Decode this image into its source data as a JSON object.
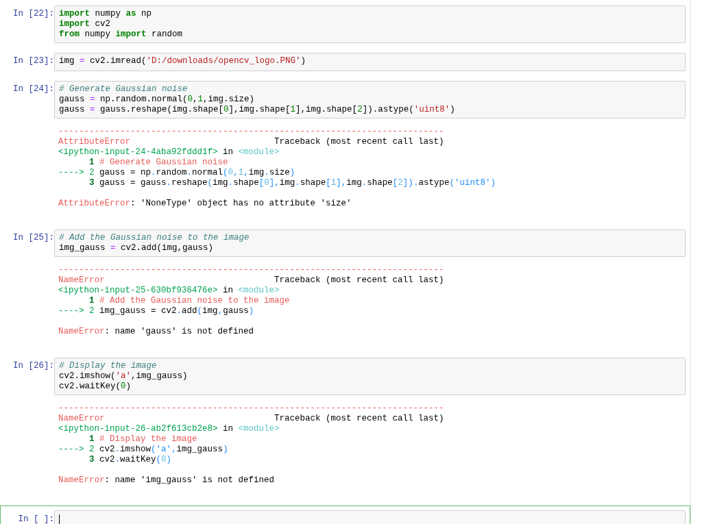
{
  "cells": [
    {
      "prompt": "In [22]:",
      "selected": false,
      "input": [
        [
          {
            "kind": "kw",
            "text": "import"
          },
          {
            "kind": "plain",
            "text": " numpy "
          },
          {
            "kind": "kw",
            "text": "as"
          },
          {
            "kind": "plain",
            "text": " np"
          }
        ],
        [
          {
            "kind": "kw",
            "text": "import"
          },
          {
            "kind": "plain",
            "text": " cv2"
          }
        ],
        [
          {
            "kind": "kw",
            "text": "from"
          },
          {
            "kind": "plain",
            "text": " numpy "
          },
          {
            "kind": "kw",
            "text": "import"
          },
          {
            "kind": "plain",
            "text": " random"
          }
        ]
      ]
    },
    {
      "prompt": "In [23]:",
      "selected": false,
      "input": [
        [
          {
            "kind": "plain",
            "text": "img "
          },
          {
            "kind": "op",
            "text": "="
          },
          {
            "kind": "plain",
            "text": " cv2.imread("
          },
          {
            "kind": "str",
            "text": "'D:/downloads/opencv_logo.PNG'"
          },
          {
            "kind": "plain",
            "text": ")"
          }
        ]
      ]
    },
    {
      "prompt": "In [24]:",
      "selected": false,
      "input": [
        [
          {
            "kind": "comment",
            "text": "# Generate Gaussian noise"
          }
        ],
        [
          {
            "kind": "plain",
            "text": "gauss "
          },
          {
            "kind": "op",
            "text": "="
          },
          {
            "kind": "plain",
            "text": " np.random.normal("
          },
          {
            "kind": "num",
            "text": "0"
          },
          {
            "kind": "plain",
            "text": ","
          },
          {
            "kind": "num",
            "text": "1"
          },
          {
            "kind": "plain",
            "text": ",img.size)"
          }
        ],
        [
          {
            "kind": "plain",
            "text": "gauss "
          },
          {
            "kind": "op",
            "text": "="
          },
          {
            "kind": "plain",
            "text": " gauss.reshape(img.shape["
          },
          {
            "kind": "num",
            "text": "0"
          },
          {
            "kind": "plain",
            "text": "],img.shape["
          },
          {
            "kind": "num",
            "text": "1"
          },
          {
            "kind": "plain",
            "text": "],img.shape["
          },
          {
            "kind": "num",
            "text": "2"
          },
          {
            "kind": "plain",
            "text": "]).astype("
          },
          {
            "kind": "str",
            "text": "'uint8'"
          },
          {
            "kind": "plain",
            "text": ")"
          }
        ]
      ],
      "output": {
        "traceback": [
          [
            {
              "kind": "ered",
              "text": "---------------------------------------------------------------------------"
            }
          ],
          [
            {
              "kind": "ered",
              "text": "AttributeError"
            },
            {
              "kind": "plain",
              "text": "                            Traceback (most recent call last)"
            }
          ],
          [
            {
              "kind": "egreen",
              "text": "<ipython-input-24-4aba92fddd1f>"
            },
            {
              "kind": "plain",
              "text": " in "
            },
            {
              "kind": "ecyan",
              "text": "<module>"
            }
          ],
          [
            {
              "kind": "lineno",
              "text": "1"
            },
            {
              "kind": "ered",
              "text": " # Generate Gaussian noise"
            }
          ],
          [
            {
              "kind": "egreen",
              "text": "----> 2"
            },
            {
              "kind": "plain",
              "text": " gauss = np"
            },
            {
              "kind": "punct",
              "text": "."
            },
            {
              "kind": "plain",
              "text": "random"
            },
            {
              "kind": "punct",
              "text": "."
            },
            {
              "kind": "plain",
              "text": "normal"
            },
            {
              "kind": "punct",
              "text": "("
            },
            {
              "kind": "tnum",
              "text": "0"
            },
            {
              "kind": "punct",
              "text": ","
            },
            {
              "kind": "tnum",
              "text": "1"
            },
            {
              "kind": "punct",
              "text": ","
            },
            {
              "kind": "plain",
              "text": "img"
            },
            {
              "kind": "punct",
              "text": "."
            },
            {
              "kind": "plain",
              "text": "size"
            },
            {
              "kind": "punct",
              "text": ")"
            }
          ],
          [
            {
              "kind": "lineno",
              "text": "3"
            },
            {
              "kind": "plain",
              "text": " gauss = gauss"
            },
            {
              "kind": "punct",
              "text": "."
            },
            {
              "kind": "plain",
              "text": "reshape"
            },
            {
              "kind": "punct",
              "text": "("
            },
            {
              "kind": "plain",
              "text": "img"
            },
            {
              "kind": "punct",
              "text": "."
            },
            {
              "kind": "plain",
              "text": "shape"
            },
            {
              "kind": "punct",
              "text": "["
            },
            {
              "kind": "tnum",
              "text": "0"
            },
            {
              "kind": "punct",
              "text": "],"
            },
            {
              "kind": "plain",
              "text": "img"
            },
            {
              "kind": "punct",
              "text": "."
            },
            {
              "kind": "plain",
              "text": "shape"
            },
            {
              "kind": "punct",
              "text": "["
            },
            {
              "kind": "tnum",
              "text": "1"
            },
            {
              "kind": "punct",
              "text": "],"
            },
            {
              "kind": "plain",
              "text": "img"
            },
            {
              "kind": "punct",
              "text": "."
            },
            {
              "kind": "plain",
              "text": "shape"
            },
            {
              "kind": "punct",
              "text": "["
            },
            {
              "kind": "tnum",
              "text": "2"
            },
            {
              "kind": "punct",
              "text": "])"
            },
            {
              "kind": "punct",
              "text": "."
            },
            {
              "kind": "plain",
              "text": "astype"
            },
            {
              "kind": "punct",
              "text": "("
            },
            {
              "kind": "tstr",
              "text": "'uint8'"
            },
            {
              "kind": "punct",
              "text": ")"
            }
          ]
        ],
        "error": [
          {
            "kind": "ered",
            "text": "AttributeError"
          },
          {
            "kind": "plain",
            "text": ": 'NoneType' object has no attribute 'size'"
          }
        ]
      }
    },
    {
      "prompt": "In [25]:",
      "selected": false,
      "input": [
        [
          {
            "kind": "comment",
            "text": "# Add the Gaussian noise to the image"
          }
        ],
        [
          {
            "kind": "plain",
            "text": "img_gauss "
          },
          {
            "kind": "op",
            "text": "="
          },
          {
            "kind": "plain",
            "text": " cv2.add(img,gauss)"
          }
        ]
      ],
      "output": {
        "traceback": [
          [
            {
              "kind": "ered",
              "text": "---------------------------------------------------------------------------"
            }
          ],
          [
            {
              "kind": "ered",
              "text": "NameError"
            },
            {
              "kind": "plain",
              "text": "                                 Traceback (most recent call last)"
            }
          ],
          [
            {
              "kind": "egreen",
              "text": "<ipython-input-25-630bf936476e>"
            },
            {
              "kind": "plain",
              "text": " in "
            },
            {
              "kind": "ecyan",
              "text": "<module>"
            }
          ],
          [
            {
              "kind": "lineno",
              "text": "1"
            },
            {
              "kind": "ered",
              "text": " # Add the Gaussian noise to the image"
            }
          ],
          [
            {
              "kind": "egreen",
              "text": "----> 2"
            },
            {
              "kind": "plain",
              "text": " img_gauss = cv2"
            },
            {
              "kind": "punct",
              "text": "."
            },
            {
              "kind": "plain",
              "text": "add"
            },
            {
              "kind": "punct",
              "text": "("
            },
            {
              "kind": "plain",
              "text": "img"
            },
            {
              "kind": "punct",
              "text": ","
            },
            {
              "kind": "plain",
              "text": "gauss"
            },
            {
              "kind": "punct",
              "text": ")"
            }
          ]
        ],
        "error": [
          {
            "kind": "ered",
            "text": "NameError"
          },
          {
            "kind": "plain",
            "text": ": name 'gauss' is not defined"
          }
        ]
      }
    },
    {
      "prompt": "In [26]:",
      "selected": false,
      "input": [
        [
          {
            "kind": "comment",
            "text": "# Display the image"
          }
        ],
        [
          {
            "kind": "plain",
            "text": "cv2.imshow("
          },
          {
            "kind": "str",
            "text": "'a'"
          },
          {
            "kind": "plain",
            "text": ",img_gauss)"
          }
        ],
        [
          {
            "kind": "plain",
            "text": "cv2.waitKey("
          },
          {
            "kind": "num",
            "text": "0"
          },
          {
            "kind": "plain",
            "text": ")"
          }
        ]
      ],
      "output": {
        "traceback": [
          [
            {
              "kind": "ered",
              "text": "---------------------------------------------------------------------------"
            }
          ],
          [
            {
              "kind": "ered",
              "text": "NameError"
            },
            {
              "kind": "plain",
              "text": "                                 Traceback (most recent call last)"
            }
          ],
          [
            {
              "kind": "egreen",
              "text": "<ipython-input-26-ab2f613cb2e8>"
            },
            {
              "kind": "plain",
              "text": " in "
            },
            {
              "kind": "ecyan",
              "text": "<module>"
            }
          ],
          [
            {
              "kind": "lineno",
              "text": "1"
            },
            {
              "kind": "ered",
              "text": " # Display the image"
            }
          ],
          [
            {
              "kind": "egreen",
              "text": "----> 2"
            },
            {
              "kind": "plain",
              "text": " cv2"
            },
            {
              "kind": "punct",
              "text": "."
            },
            {
              "kind": "plain",
              "text": "imshow"
            },
            {
              "kind": "punct",
              "text": "("
            },
            {
              "kind": "tstr",
              "text": "'a'"
            },
            {
              "kind": "punct",
              "text": ","
            },
            {
              "kind": "plain",
              "text": "img_gauss"
            },
            {
              "kind": "punct",
              "text": ")"
            }
          ],
          [
            {
              "kind": "lineno",
              "text": "3"
            },
            {
              "kind": "plain",
              "text": " cv2"
            },
            {
              "kind": "punct",
              "text": "."
            },
            {
              "kind": "plain",
              "text": "waitKey"
            },
            {
              "kind": "punct",
              "text": "("
            },
            {
              "kind": "tnum",
              "text": "0"
            },
            {
              "kind": "punct",
              "text": ")"
            }
          ]
        ],
        "error": [
          {
            "kind": "ered",
            "text": "NameError"
          },
          {
            "kind": "plain",
            "text": ": name 'img_gauss' is not defined"
          }
        ]
      }
    },
    {
      "prompt": "In [ ]:",
      "selected": true
    }
  ]
}
